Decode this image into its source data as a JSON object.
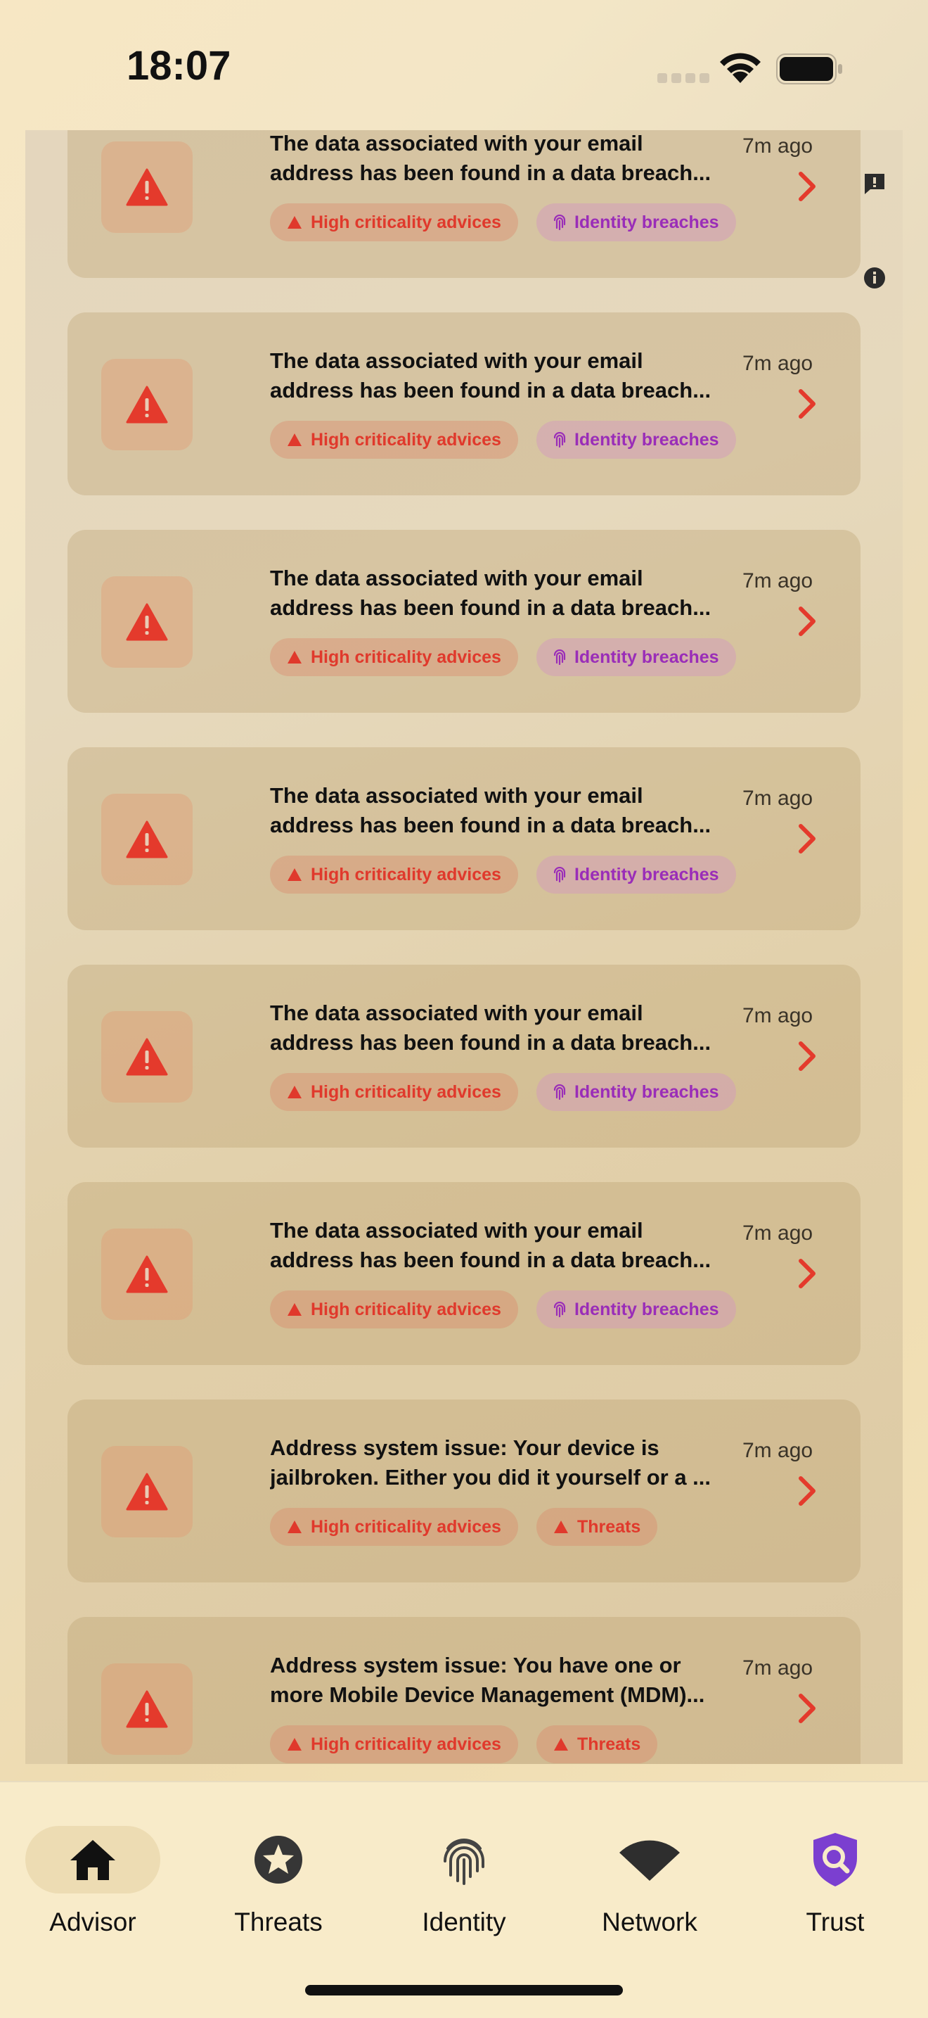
{
  "status_bar": {
    "time": "18:07"
  },
  "colors": {
    "alert_red": "#e0392c",
    "identity_purple": "#9a2db8",
    "trust_purple": "#7b3fd0"
  },
  "notifications": [
    {
      "line1": "The data associated with your email",
      "line2": "address has been found in a data breach...",
      "time": "7m ago",
      "chip1": "High criticality advices",
      "chip2": "Identity breaches",
      "chip2_type": "identity"
    },
    {
      "line1": "The data associated with your email",
      "line2": "address has been found in a data breach...",
      "time": "7m ago",
      "chip1": "High criticality advices",
      "chip2": "Identity breaches",
      "chip2_type": "identity"
    },
    {
      "line1": "The data associated with your email",
      "line2": "address has been found in a data breach...",
      "time": "7m ago",
      "chip1": "High criticality advices",
      "chip2": "Identity breaches",
      "chip2_type": "identity"
    },
    {
      "line1": "The data associated with your email",
      "line2": "address has been found in a data breach...",
      "time": "7m ago",
      "chip1": "High criticality advices",
      "chip2": "Identity breaches",
      "chip2_type": "identity"
    },
    {
      "line1": "The data associated with your email",
      "line2": "address has been found in a data breach...",
      "time": "7m ago",
      "chip1": "High criticality advices",
      "chip2": "Identity breaches",
      "chip2_type": "identity"
    },
    {
      "line1": "The data associated with your email",
      "line2": "address has been found in a data breach...",
      "time": "7m ago",
      "chip1": "High criticality advices",
      "chip2": "Identity breaches",
      "chip2_type": "identity"
    },
    {
      "line1": "Address system issue: Your device is",
      "line2": "jailbroken. Either you did it yourself or a ...",
      "time": "7m ago",
      "chip1": "High criticality advices",
      "chip2": "Threats",
      "chip2_type": "threat"
    },
    {
      "line1": "Address system issue: You have one or",
      "line2": "more Mobile Device Management (MDM)...",
      "time": "7m ago",
      "chip1": "High criticality advices",
      "chip2": "Threats",
      "chip2_type": "threat"
    }
  ],
  "tabs": [
    {
      "label": "Advisor",
      "icon": "home-icon",
      "active": true
    },
    {
      "label": "Threats",
      "icon": "star-circle-icon",
      "active": false
    },
    {
      "label": "Identity",
      "icon": "fingerprint-icon",
      "active": false
    },
    {
      "label": "Network",
      "icon": "wifi-icon",
      "active": false
    },
    {
      "label": "Trust",
      "icon": "shield-search-icon",
      "active": false
    }
  ]
}
